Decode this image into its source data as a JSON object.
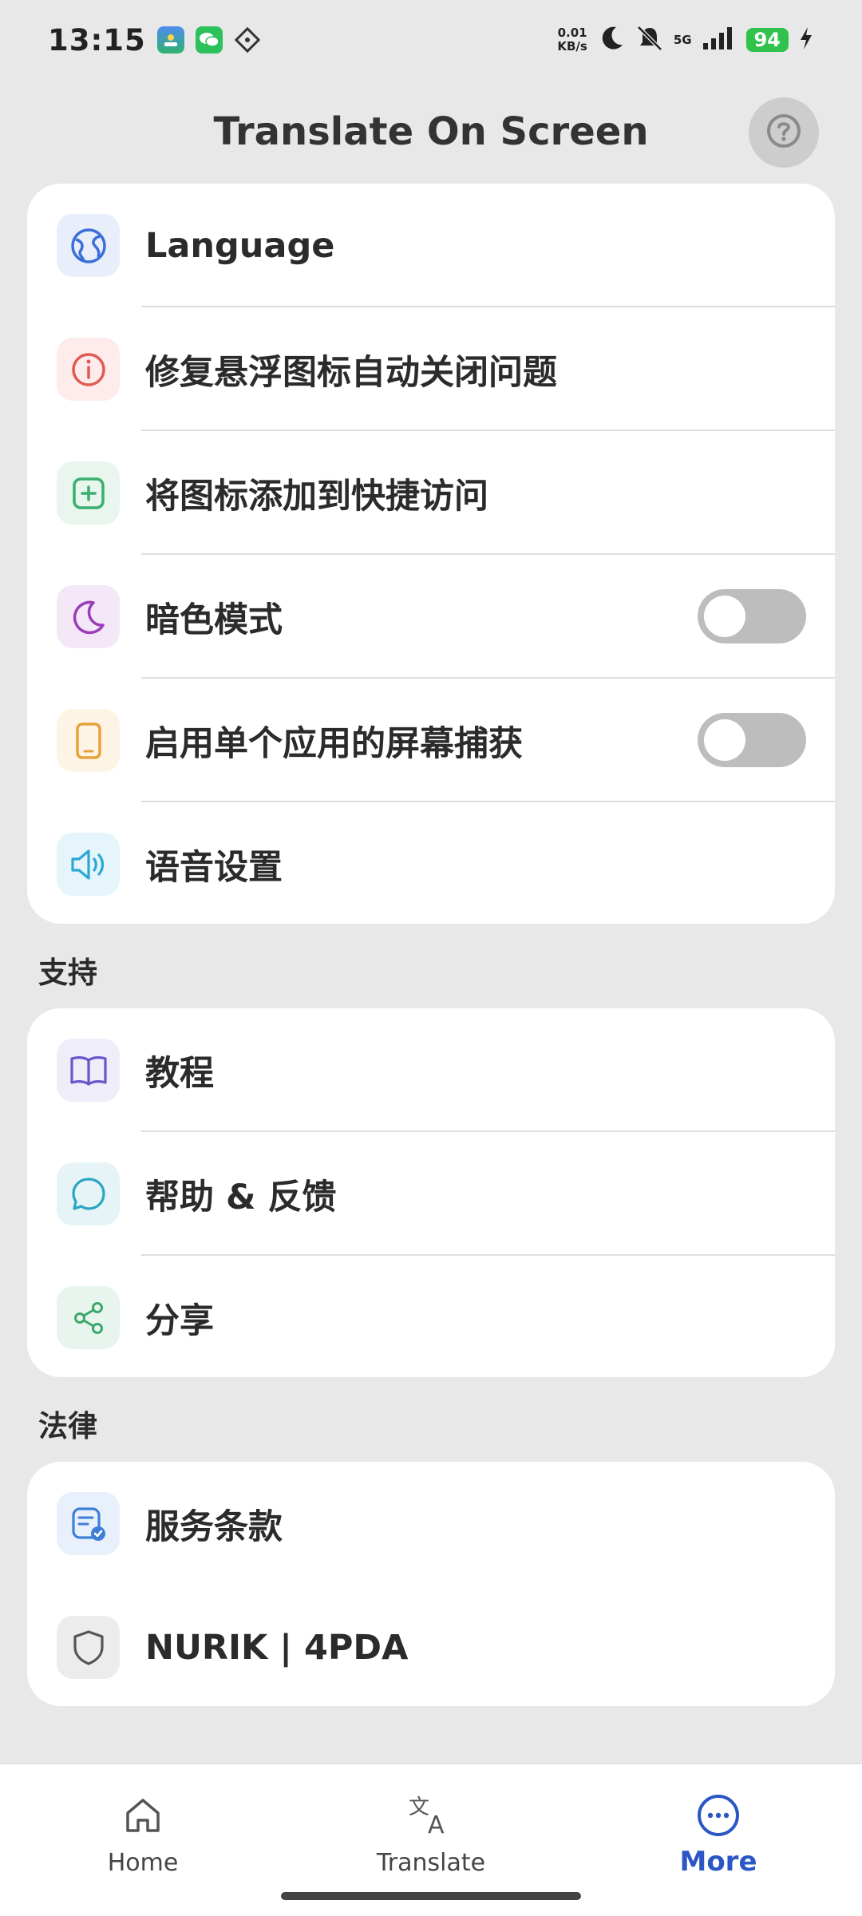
{
  "status_bar": {
    "time": "13:15",
    "net_speed_value": "0.01",
    "net_speed_unit": "KB/s",
    "network": "5G",
    "battery": "94",
    "icons": [
      "photo-app-icon",
      "wechat-icon",
      "grid-app-icon",
      "moon-icon",
      "bell-off-icon",
      "signal-icon",
      "charging-icon"
    ]
  },
  "header": {
    "title": "Translate On Screen",
    "help_icon": "help-circle-icon"
  },
  "settings": {
    "items": [
      {
        "label": "Language",
        "icon": "globe-icon",
        "color": "#3b6fd8",
        "bg": "#e9eefb"
      },
      {
        "label": "修复悬浮图标自动关闭问题",
        "icon": "info-icon",
        "color": "#e05a52",
        "bg": "#fdeceb"
      },
      {
        "label": "将图标添加到快捷访问",
        "icon": "add-square-icon",
        "color": "#3aae6e",
        "bg": "#e8f6ee"
      },
      {
        "label": "暗色模式",
        "icon": "moon-icon",
        "color": "#9b3db6",
        "bg": "#f4e8f8",
        "toggle": false
      },
      {
        "label": "启用单个应用的屏幕捕获",
        "icon": "phone-icon",
        "color": "#e8a23c",
        "bg": "#fdf4e6",
        "toggle": false
      },
      {
        "label": "语音设置",
        "icon": "speaker-icon",
        "color": "#2aa7d6",
        "bg": "#e6f5fb"
      }
    ]
  },
  "support": {
    "title": "支持",
    "items": [
      {
        "label": "教程",
        "icon": "book-icon",
        "color": "#6a55c9",
        "bg": "#efedfa"
      },
      {
        "label": "帮助 & 反馈",
        "icon": "chat-bubble-icon",
        "color": "#2aa6c2",
        "bg": "#e6f4f7"
      },
      {
        "label": "分享",
        "icon": "share-icon",
        "color": "#3aa86a",
        "bg": "#e8f5ee"
      }
    ]
  },
  "legal": {
    "title": "法律",
    "items": [
      {
        "label": "服务条款",
        "icon": "document-check-icon",
        "color": "#3b7fd8",
        "bg": "#e8f1fb"
      },
      {
        "label": "NURIK | 4PDA",
        "icon": "shield-icon",
        "color": "#555555",
        "bg": "#ececec"
      }
    ]
  },
  "bottom_nav": {
    "items": [
      {
        "label": "Home",
        "icon": "home-icon",
        "active": false
      },
      {
        "label": "Translate",
        "icon": "translate-icon",
        "active": false
      },
      {
        "label": "More",
        "icon": "more-circle-icon",
        "active": true
      }
    ],
    "active_color": "#2a56c6"
  }
}
